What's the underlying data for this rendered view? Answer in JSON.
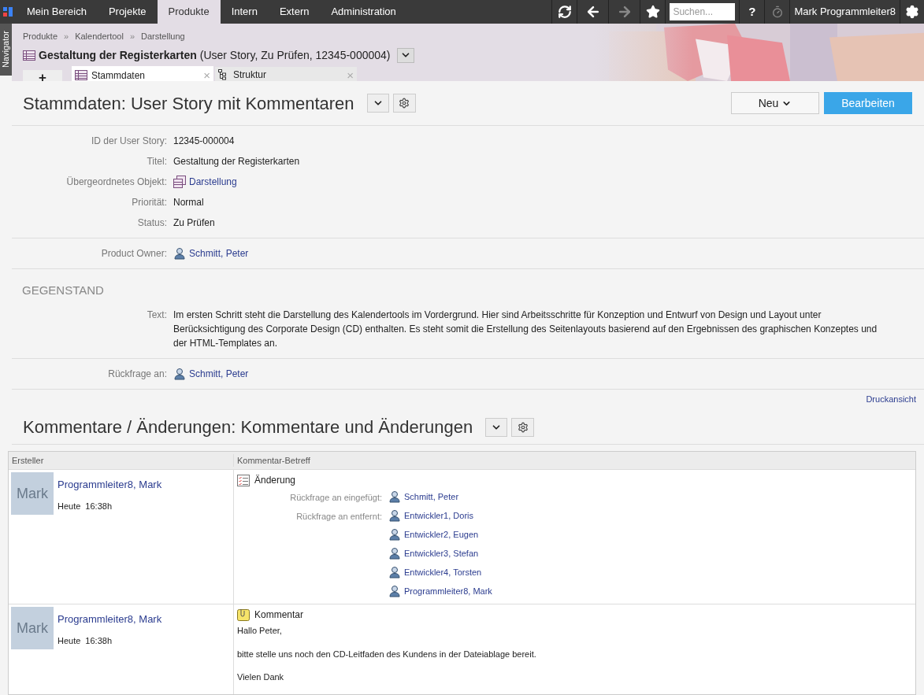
{
  "topbar": {
    "nav": [
      {
        "label": "Mein Bereich",
        "selected": false
      },
      {
        "label": "Projekte",
        "selected": false
      },
      {
        "label": "Produkte",
        "selected": true
      },
      {
        "label": "Intern",
        "selected": false
      },
      {
        "label": "Extern",
        "selected": false
      },
      {
        "label": "Administration",
        "selected": false
      }
    ],
    "search": {
      "placeholder": "Suchen..."
    },
    "help": "?",
    "user": "Mark Programmleiter8"
  },
  "navigator": "Navigator",
  "breadcrumb": {
    "items": [
      "Produkte",
      "Kalendertool",
      "Darstellung"
    ],
    "separator": "»"
  },
  "object": {
    "name": "Gestaltung der Registerkarten",
    "details": "(User Story, Zu Prüfen, 12345-000004)"
  },
  "tabs": {
    "add": "+",
    "close": "×",
    "items": [
      {
        "label": "Stammdaten",
        "selected": true,
        "kind": "list"
      },
      {
        "label": "Struktur",
        "selected": false,
        "kind": "tree"
      }
    ]
  },
  "master": {
    "title": "Stammdaten: User Story mit Kommentaren",
    "new_button": "Neu",
    "edit_button": "Bearbeiten",
    "groups": [
      {
        "fields": [
          {
            "label": "ID der User Story:",
            "value": "12345-000004",
            "kind": "text"
          },
          {
            "label": "Titel:",
            "value": "Gestaltung der Registerkarten",
            "kind": "text"
          },
          {
            "label": "Übergeordnetes Objekt:",
            "value": "Darstellung",
            "kind": "object"
          },
          {
            "label": "Priorität:",
            "value": "Normal",
            "kind": "text"
          },
          {
            "label": "Status:",
            "value": "Zu Prüfen",
            "kind": "text"
          }
        ]
      },
      {
        "fields": [
          {
            "label": "Product Owner:",
            "value": "Schmitt, Peter",
            "kind": "person"
          }
        ]
      },
      {
        "heading": "GEGENSTAND",
        "fields": [
          {
            "label": "Text:",
            "value": "Im ersten Schritt steht die Darstellung des Kalendertools im Vordergrund. Hier sind Arbeitsschritte für Konzeption und Entwurf von Design und Layout unter Berücksichtigung des Corporate Design (CD) enthalten. Es steht somit die Erstellung des Seitenlayouts basierend auf den Ergebnissen des graphischen Konzeptes und der HTML-Templates an.",
            "kind": "text"
          }
        ]
      },
      {
        "fields": [
          {
            "label": "Rückfrage an:",
            "value": "Schmitt, Peter",
            "kind": "person"
          }
        ]
      }
    ],
    "print_link": "Druckansicht"
  },
  "comments": {
    "title": "Kommentare / Änderungen: Kommentare und Änderungen",
    "columns": [
      "Ersteller",
      "Kommentar-Betreff"
    ],
    "rows": [
      {
        "avatar": "Mark",
        "author": "Programmleiter8, Mark",
        "day": "Heute",
        "time": "16:38h",
        "kind": "change",
        "subject": "Änderung",
        "changes": [
          {
            "label": "Rückfrage an eingefügt:",
            "people": [
              "Schmitt, Peter"
            ]
          },
          {
            "label": "Rückfrage an entfernt:",
            "people": [
              "Entwickler1, Doris",
              "Entwickler2, Eugen",
              "Entwickler3, Stefan",
              "Entwickler4, Torsten",
              "Programmleiter8, Mark"
            ]
          }
        ]
      },
      {
        "avatar": "Mark",
        "author": "Programmleiter8, Mark",
        "day": "Heute",
        "time": "16:38h",
        "kind": "comment",
        "subject": "Kommentar",
        "paragraphs": [
          "Hallo Peter,",
          "bitte stelle uns noch den CD-Leitfaden des Kundens in der Dateiablage bereit.",
          "Vielen Dank"
        ]
      }
    ]
  }
}
